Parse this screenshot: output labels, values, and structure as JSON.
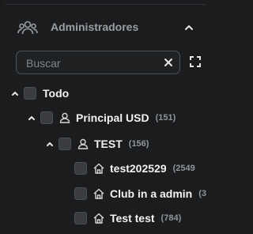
{
  "section": {
    "title": "Administradores",
    "icon": "users-icon",
    "collapse_icon": "chevron-up-icon"
  },
  "search": {
    "placeholder": "Buscar",
    "value": "",
    "clear_icon": "close-icon",
    "expand_icon": "fullscreen-icon"
  },
  "tree": {
    "root": {
      "label": "Todo",
      "expanded": true
    },
    "level1": {
      "label": "Principal USD",
      "count": "(151)",
      "expanded": true,
      "icon": "user-icon"
    },
    "level2": {
      "label": "TEST",
      "count": "(156)",
      "expanded": true,
      "icon": "user-icon"
    },
    "leaves": [
      {
        "label": "test202529",
        "count": "(2549",
        "icon": "home-icon"
      },
      {
        "label": "Club in a admin",
        "count": "(3",
        "icon": "home-icon"
      },
      {
        "label": "Test test",
        "count": "(784)",
        "icon": "home-icon"
      }
    ]
  }
}
